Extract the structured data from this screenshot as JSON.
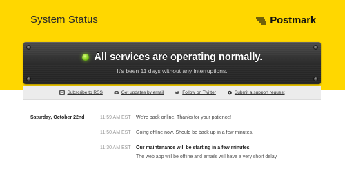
{
  "header": {
    "title": "System Status",
    "brand": "Postmark"
  },
  "status_panel": {
    "headline": "All services are operating normally.",
    "subline": "It's been 11 days without any interruptions."
  },
  "actions": [
    {
      "label": "Subscribe to RSS",
      "icon": "rss-icon"
    },
    {
      "label": "Get updates by email",
      "icon": "email-icon"
    },
    {
      "label": "Follow on Twitter",
      "icon": "twitter-bird-icon"
    },
    {
      "label": "Submit a support request",
      "icon": "support-icon"
    }
  ],
  "timeline": {
    "date": "Saturday, October 22nd",
    "events": [
      {
        "time": "11:59 AM EST",
        "message": "We're back online. Thanks for your patience!"
      },
      {
        "time": "11:50 AM EST",
        "message": "Going offline now. Should be back up in a few minutes."
      },
      {
        "time": "11:30 AM EST",
        "message": "Our maintenance will be starting in a few minutes.",
        "detail": "The web app will be offline and emails will have a very short delay."
      }
    ]
  },
  "colors": {
    "brand_yellow": "#ffd700",
    "panel_dark": "#2a2a2a",
    "status_green": "#7cc51a"
  }
}
